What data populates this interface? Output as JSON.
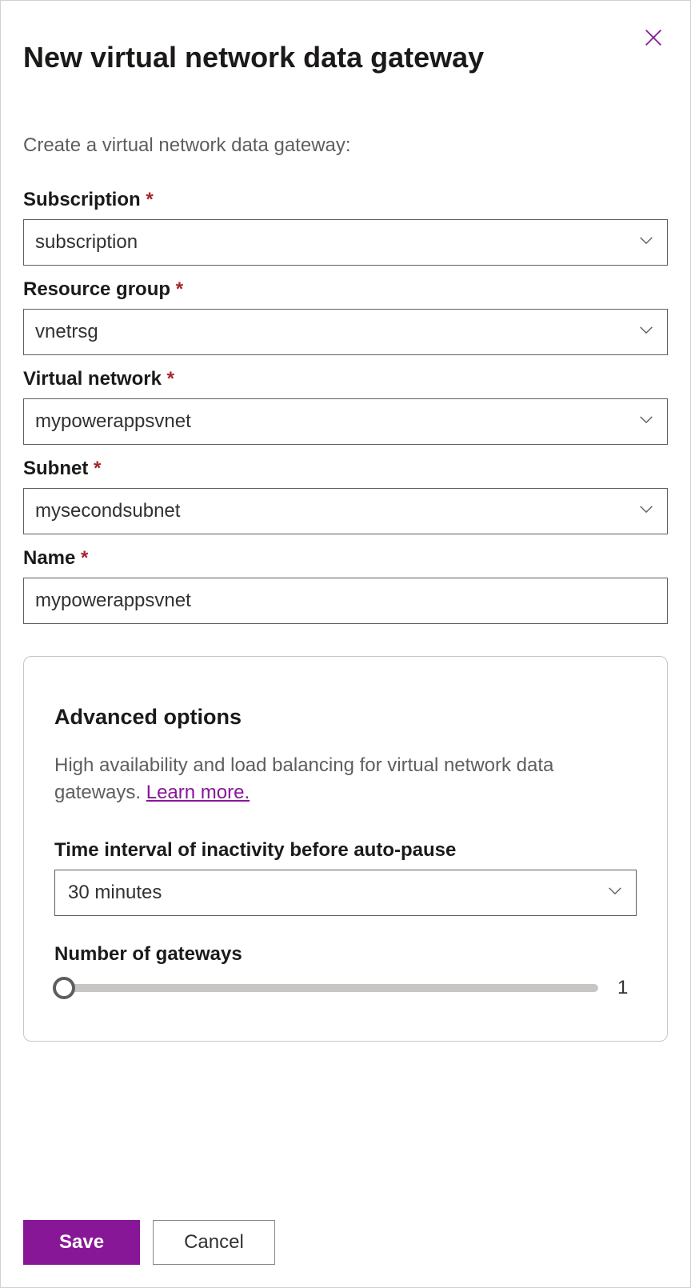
{
  "header": {
    "title": "New virtual network data gateway"
  },
  "subtitle": "Create a virtual network data gateway:",
  "fields": {
    "subscription": {
      "label": "Subscription",
      "value": "subscription"
    },
    "resourceGroup": {
      "label": "Resource group",
      "value": "vnetrsg"
    },
    "virtualNetwork": {
      "label": "Virtual network",
      "value": "mypowerappsvnet"
    },
    "subnet": {
      "label": "Subnet",
      "value": "mysecondsubnet"
    },
    "name": {
      "label": "Name",
      "value": "mypowerappsvnet"
    }
  },
  "advanced": {
    "title": "Advanced options",
    "description": "High availability and load balancing for virtual network data gateways.",
    "learnMore": "Learn more.",
    "inactivity": {
      "label": "Time interval of inactivity before auto-pause",
      "value": "30 minutes"
    },
    "gateways": {
      "label": "Number of gateways",
      "value": "1"
    }
  },
  "footer": {
    "save": "Save",
    "cancel": "Cancel"
  },
  "requiredMarker": "*"
}
